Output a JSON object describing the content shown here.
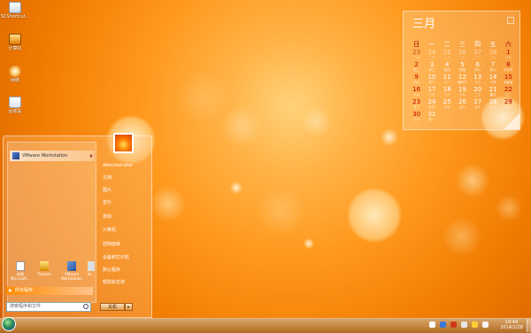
{
  "desktop": {
    "icons": [
      {
        "label": "SCShortcut..."
      },
      {
        "label": "计算机"
      },
      {
        "label": "网络"
      },
      {
        "label": "回收站"
      }
    ]
  },
  "calendar": {
    "month": "三月",
    "weekdays": [
      "日",
      "一",
      "二",
      "三",
      "四",
      "五",
      "六"
    ],
    "weeks": [
      [
        {
          "n": "23",
          "l": "二四",
          "o": true
        },
        {
          "n": "24",
          "l": "二五",
          "o": true
        },
        {
          "n": "25",
          "l": "二六",
          "o": true
        },
        {
          "n": "26",
          "l": "二七",
          "o": true
        },
        {
          "n": "27",
          "l": "二八",
          "o": true
        },
        {
          "n": "28",
          "l": "二九",
          "o": true
        },
        {
          "n": "1",
          "l": "三十"
        }
      ],
      [
        {
          "n": "2",
          "l": "初二"
        },
        {
          "n": "3",
          "l": "初三"
        },
        {
          "n": "4",
          "l": "初四"
        },
        {
          "n": "5",
          "l": "惊蛰"
        },
        {
          "n": "6",
          "l": "初六"
        },
        {
          "n": "7",
          "l": "初七"
        },
        {
          "n": "8",
          "l": "妇女节"
        }
      ],
      [
        {
          "n": "9",
          "l": "初九"
        },
        {
          "n": "10",
          "l": "初十"
        },
        {
          "n": "11",
          "l": "十一"
        },
        {
          "n": "12",
          "l": "植树节"
        },
        {
          "n": "13",
          "l": "十三"
        },
        {
          "n": "14",
          "l": "十四"
        },
        {
          "n": "15",
          "l": "消费者"
        }
      ],
      [
        {
          "n": "16",
          "l": "十六"
        },
        {
          "n": "17",
          "l": "十七"
        },
        {
          "n": "18",
          "l": "十八"
        },
        {
          "n": "19",
          "l": "十九"
        },
        {
          "n": "20",
          "l": "二十"
        },
        {
          "n": "21",
          "l": "春分"
        },
        {
          "n": "22",
          "l": "廿二"
        }
      ],
      [
        {
          "n": "23",
          "l": "廿三"
        },
        {
          "n": "24",
          "l": "廿四"
        },
        {
          "n": "25",
          "l": "廿五"
        },
        {
          "n": "26",
          "l": "廿六"
        },
        {
          "n": "27",
          "l": "廿七"
        },
        {
          "n": "28",
          "l": "廿八"
        },
        {
          "n": "29",
          "l": "廿九"
        }
      ],
      [
        {
          "n": "30",
          "l": "三十"
        },
        {
          "n": "31",
          "l": "初一"
        },
        {
          "n": "",
          "l": ""
        },
        {
          "n": "",
          "l": ""
        },
        {
          "n": "",
          "l": ""
        },
        {
          "n": "",
          "l": ""
        },
        {
          "n": "",
          "l": ""
        }
      ]
    ]
  },
  "start_menu": {
    "pinned_app": "VMware Workstation",
    "user_name": "Administrator",
    "right_items": [
      "文档",
      "图片",
      "音乐",
      "游戏",
      "计算机",
      "控制面板",
      "设备和打印机",
      "默认程序",
      "帮助和支持"
    ],
    "bottom_apps": [
      {
        "label": "新建 Microsoft..."
      },
      {
        "label": "Themes"
      },
      {
        "label": "VMware Workstation"
      },
      {
        "label": "wi..."
      }
    ],
    "all_programs": "所有程序",
    "search_placeholder": "搜索程序和文件",
    "shutdown": "关机"
  },
  "taskbar": {
    "time": "14:44",
    "date": "2014/2/28"
  }
}
